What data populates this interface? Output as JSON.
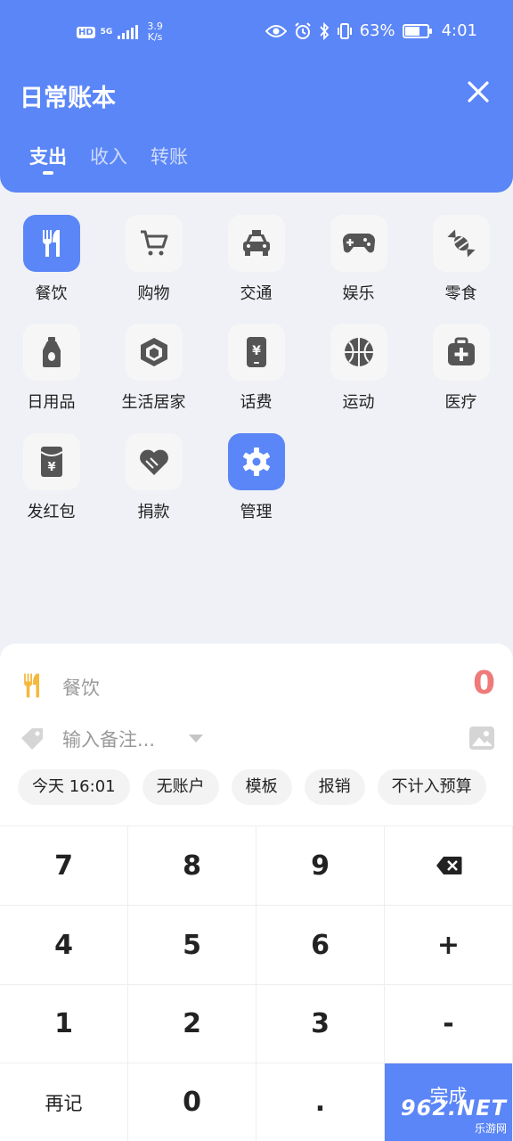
{
  "status_bar": {
    "hd": "HD",
    "network": "5G",
    "speed_top": "3.9",
    "speed_bottom": "K/s",
    "battery": "63%",
    "time": "4:01"
  },
  "header": {
    "title": "日常账本",
    "tabs": [
      {
        "label": "支出"
      },
      {
        "label": "收入"
      },
      {
        "label": "转账"
      }
    ]
  },
  "categories": [
    {
      "label": "餐饮",
      "icon": "utensils-icon",
      "selected": true
    },
    {
      "label": "购物",
      "icon": "cart-icon"
    },
    {
      "label": "交通",
      "icon": "taxi-icon"
    },
    {
      "label": "娱乐",
      "icon": "gamepad-icon"
    },
    {
      "label": "零食",
      "icon": "candy-icon"
    },
    {
      "label": "日用品",
      "icon": "bottle-icon"
    },
    {
      "label": "生活居家",
      "icon": "cube-icon"
    },
    {
      "label": "话费",
      "icon": "phone-yen-icon"
    },
    {
      "label": "运动",
      "icon": "basketball-icon"
    },
    {
      "label": "医疗",
      "icon": "medkit-icon"
    },
    {
      "label": "发红包",
      "icon": "red-envelope-icon"
    },
    {
      "label": "捐款",
      "icon": "heart-hands-icon"
    },
    {
      "label": "管理",
      "icon": "gear-icon",
      "selected": true
    }
  ],
  "entry": {
    "category": "餐饮",
    "amount": "0",
    "note_placeholder": "输入备注...",
    "chips": [
      "今天 16:01",
      "无账户",
      "模板",
      "报销",
      "不计入预算"
    ]
  },
  "keypad": {
    "keys": [
      "7",
      "8",
      "9",
      "",
      "4",
      "5",
      "6",
      "+",
      "1",
      "2",
      "3",
      "-",
      "再记",
      "0",
      ".",
      "完成"
    ]
  },
  "watermark": {
    "big": "962.NET",
    "small": "乐游网"
  },
  "colors": {
    "accent": "#5b86f7",
    "amount": "#ee7a7a",
    "food_icon": "#f5b83d"
  }
}
